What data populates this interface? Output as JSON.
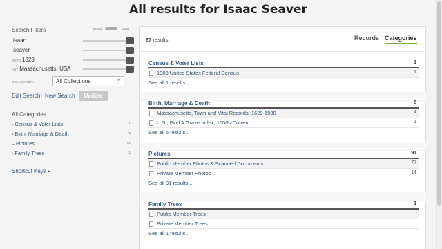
{
  "page": {
    "title": "All results for Isaac Seaver"
  },
  "sidebar": {
    "filters_title": "Search Filters",
    "broad_label": "Broad",
    "exact_label": "Exact",
    "filters": [
      {
        "label": "",
        "value": "isaac"
      },
      {
        "label": "",
        "value": "seaver"
      },
      {
        "label": "BORN",
        "value": "1823"
      },
      {
        "label": "ANY",
        "value": "Massachusetts, USA"
      }
    ],
    "collection_label": "COLLECTION:",
    "collection_value": "All Collections",
    "edit_search": "Edit Search",
    "separator": "|",
    "new_search": "New Search",
    "update": "Update",
    "all_categories": "All Categories",
    "categories": [
      {
        "glyph": "›",
        "name": "Census & Voter Lists",
        "count": "1"
      },
      {
        "glyph": "›",
        "name": "Birth, Marriage & Death",
        "count": "5"
      },
      {
        "glyph": "–",
        "name": "Pictures",
        "count": "91"
      },
      {
        "glyph": "›",
        "name": "Family Trees",
        "count": "1"
      }
    ],
    "shortcut_keys": "Shortcut Keys ▸"
  },
  "results": {
    "count_number": "97",
    "count_suffix": " results",
    "tabs": {
      "records": "Records",
      "categories": "Categories"
    },
    "sections": [
      {
        "name": "Census & Voter Lists",
        "count": "1",
        "rows": [
          {
            "name": "1900 United States Federal Census",
            "count": "1"
          }
        ],
        "see_all": "See all 1 results..."
      },
      {
        "name": "Birth, Marriage & Death",
        "count": "5",
        "rows": [
          {
            "name": "Massachusetts, Town and Vital Records, 1620-1988",
            "count": "4"
          },
          {
            "name": "U.S., Find A Grave Index, 1600s-Current",
            "count": "1"
          }
        ],
        "see_all": "See all 5 results..."
      },
      {
        "name": "Pictures",
        "count": "91",
        "rows": [
          {
            "name": "Public Member Photos & Scanned Documents",
            "count": "77"
          },
          {
            "name": "Private Member Photos",
            "count": "14"
          }
        ],
        "see_all": "See all 91 results..."
      },
      {
        "name": "Family Trees",
        "count": "1",
        "rows": [
          {
            "name": "Public Member Trees",
            "count": ""
          },
          {
            "name": "Private Member Trees",
            "count": ""
          }
        ],
        "see_all": "See all 1 results..."
      }
    ]
  }
}
